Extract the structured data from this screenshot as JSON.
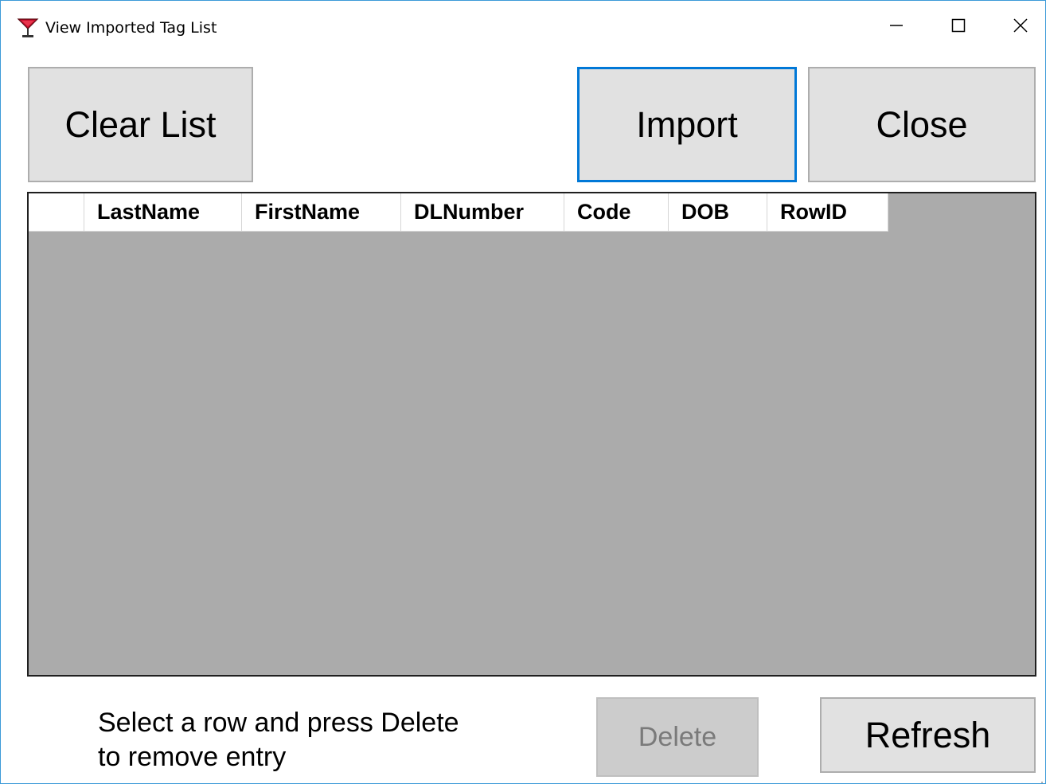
{
  "window": {
    "title": "View Imported Tag List",
    "icon": "cocktail-glass-icon",
    "border_color": "#3c9ad8"
  },
  "toolbar": {
    "clear_label": "Clear List",
    "import_label": "Import",
    "close_label": "Close"
  },
  "grid": {
    "background": "#ababab",
    "columns": [
      "LastName",
      "FirstName",
      "DLNumber",
      "Code",
      "DOB",
      "RowID"
    ],
    "rows": []
  },
  "footer": {
    "instruction_line1": "Select a row and press Delete",
    "instruction_line2": "to remove entry",
    "delete_label": "Delete",
    "refresh_label": "Refresh"
  },
  "colors": {
    "accent": "#0078d7",
    "button_bg": "#e1e1e1",
    "button_disabled_bg": "#cccccc"
  }
}
